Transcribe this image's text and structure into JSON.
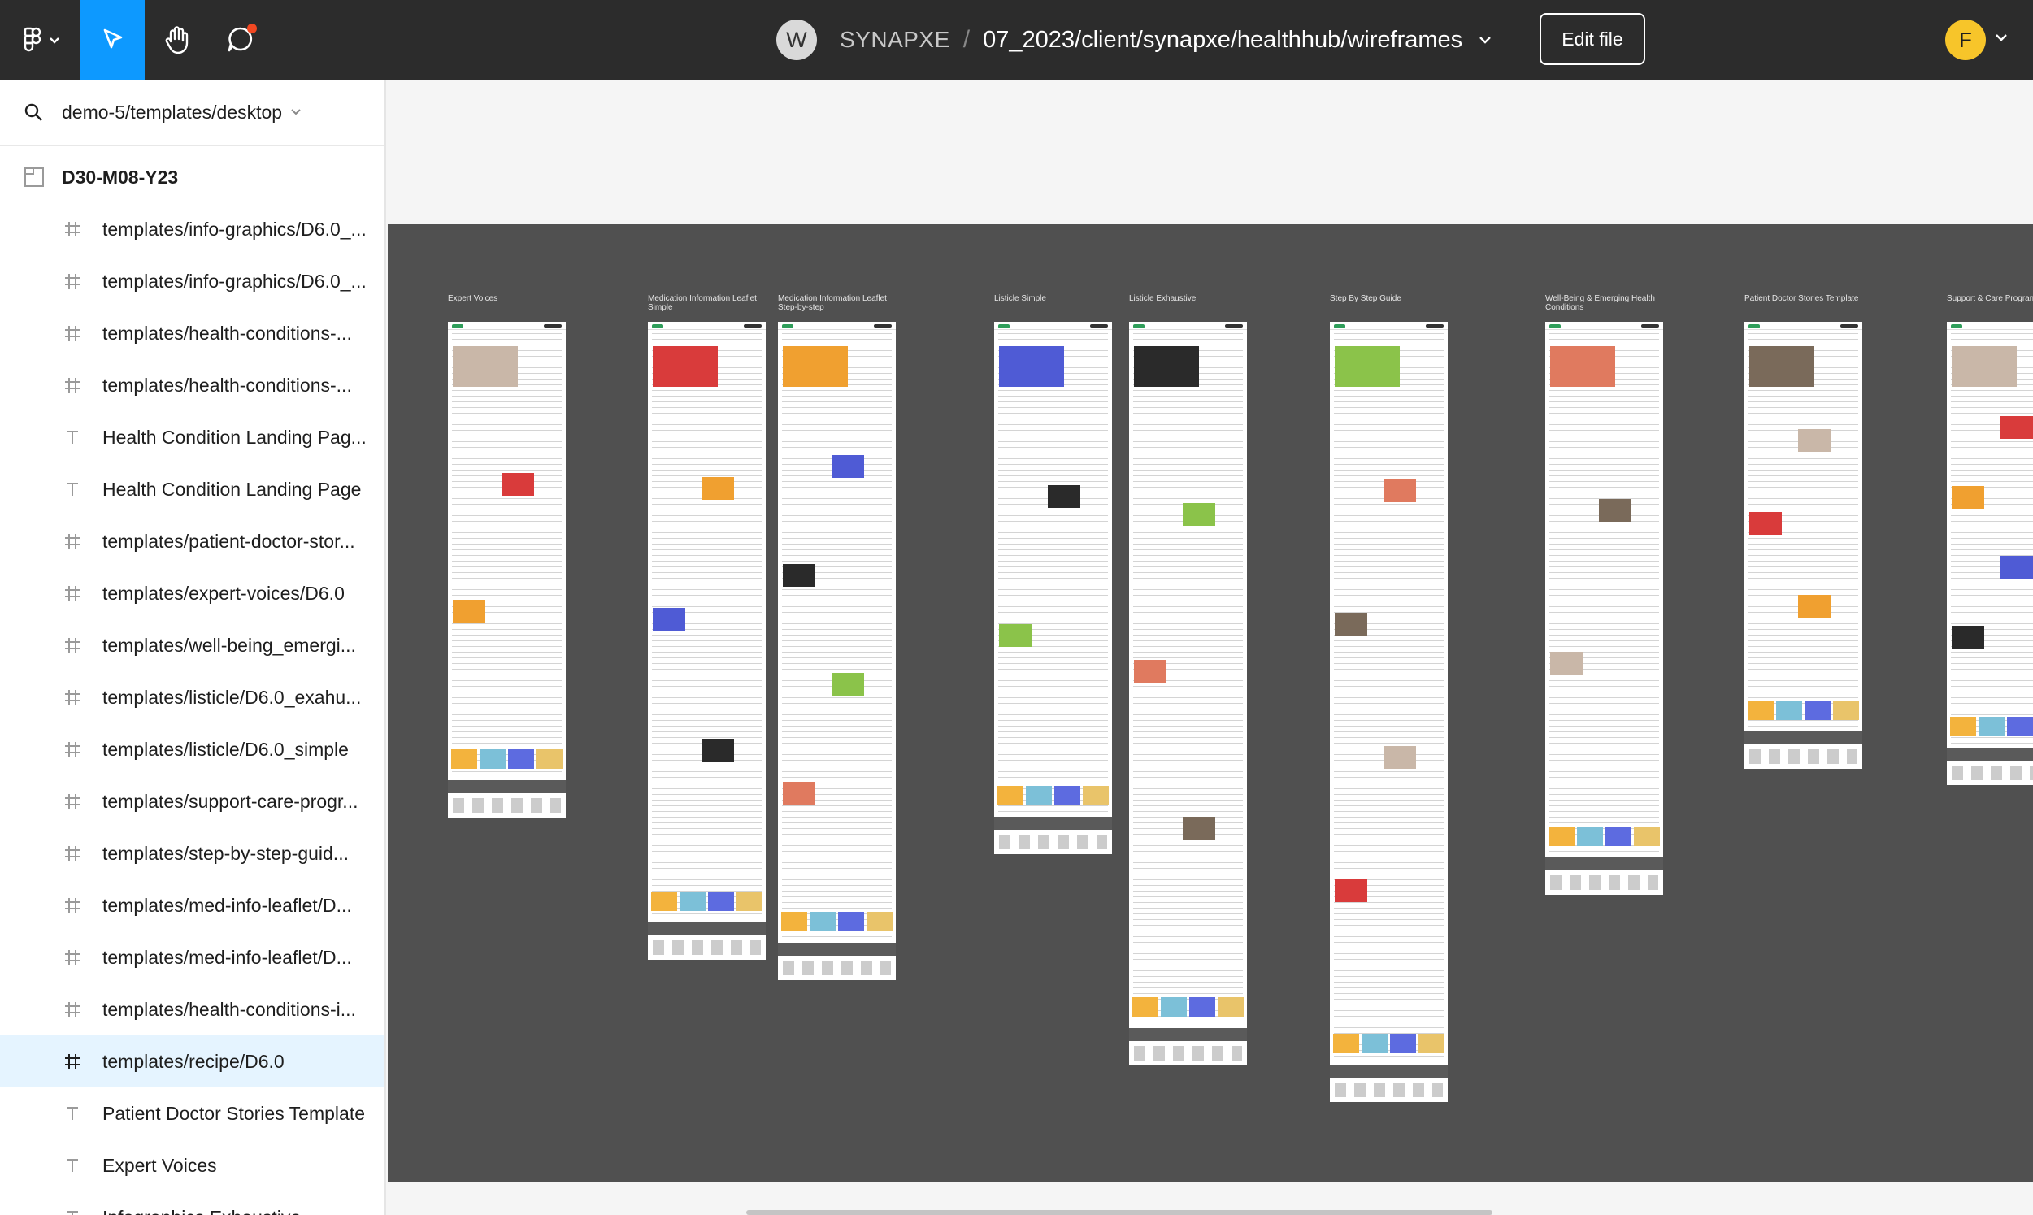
{
  "topbar": {
    "workspace_initial": "W",
    "workspace_name": "SYNAPXE",
    "separator": "/",
    "file_path": "07_2023/client/synapxe/healthhub/wireframes",
    "edit_button": "Edit file",
    "user_initial": "F",
    "comment_badge_color": "#f24822",
    "move_tool_color": "#0d99ff"
  },
  "left_panel": {
    "search_text": "demo-5/templates/desktop",
    "page_name": "D30-M08-Y23",
    "layers": [
      {
        "label": "templates/info-graphics/D6.0_...",
        "icon": "frame-icon",
        "selected": false
      },
      {
        "label": "templates/info-graphics/D6.0_...",
        "icon": "frame-icon",
        "selected": false
      },
      {
        "label": "templates/health-conditions-...",
        "icon": "frame-icon",
        "selected": false
      },
      {
        "label": "templates/health-conditions-...",
        "icon": "frame-icon",
        "selected": false
      },
      {
        "label": "Health Condition Landing Pag...",
        "icon": "text-icon",
        "selected": false
      },
      {
        "label": "Health Condition Landing Page",
        "icon": "text-icon",
        "selected": false
      },
      {
        "label": "templates/patient-doctor-stor...",
        "icon": "frame-icon",
        "selected": false
      },
      {
        "label": "templates/expert-voices/D6.0",
        "icon": "frame-icon",
        "selected": false
      },
      {
        "label": "templates/well-being_emergi...",
        "icon": "frame-icon",
        "selected": false
      },
      {
        "label": "templates/listicle/D6.0_exahu...",
        "icon": "frame-icon",
        "selected": false
      },
      {
        "label": "templates/listicle/D6.0_simple",
        "icon": "frame-icon",
        "selected": false
      },
      {
        "label": "templates/support-care-progr...",
        "icon": "frame-icon",
        "selected": false
      },
      {
        "label": "templates/step-by-step-guid...",
        "icon": "frame-icon",
        "selected": false
      },
      {
        "label": "templates/med-info-leaflet/D...",
        "icon": "frame-icon",
        "selected": false
      },
      {
        "label": "templates/med-info-leaflet/D...",
        "icon": "frame-icon",
        "selected": false
      },
      {
        "label": "templates/health-conditions-i...",
        "icon": "frame-icon",
        "selected": false
      },
      {
        "label": "templates/recipe/D6.0",
        "icon": "frame-icon",
        "selected": true
      },
      {
        "label": "Patient Doctor Stories Template",
        "icon": "text-icon",
        "selected": false
      },
      {
        "label": "Expert Voices",
        "icon": "text-icon",
        "selected": false
      },
      {
        "label": "Infographics Exhaustive",
        "icon": "text-icon",
        "selected": false
      }
    ]
  },
  "canvas": {
    "frames": [
      {
        "title": "Expert Voices"
      },
      {
        "title": "Medication Information Leaflet Simple"
      },
      {
        "title": "Medication Information Leaflet Step-by-step"
      },
      {
        "title": "Listicle Simple"
      },
      {
        "title": "Listicle Exhaustive"
      },
      {
        "title": "Step By Step Guide"
      },
      {
        "title": "Well-Being & Emerging Health Conditions"
      },
      {
        "title": "Patient Doctor Stories Template"
      },
      {
        "title": "Support & Care Program"
      }
    ]
  }
}
